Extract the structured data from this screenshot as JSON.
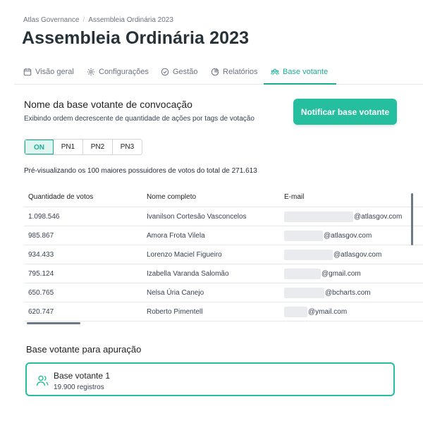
{
  "breadcrumb": {
    "root": "Atlas Governance",
    "current": "Assembleia Ordinária 2023"
  },
  "page_title": "Assembleia Ordinária 2023",
  "tabs": [
    {
      "label": "Visão geral",
      "icon": "calendar-icon"
    },
    {
      "label": "Configurações",
      "icon": "gear-icon"
    },
    {
      "label": "Gestão",
      "icon": "check-circle-icon"
    },
    {
      "label": "Relatórios",
      "icon": "pie-chart-icon"
    },
    {
      "label": "Base votante",
      "icon": "users-icon",
      "active": true
    }
  ],
  "section": {
    "title": "Nome da base votante de convocação",
    "subtitle": "Exibindo ordem decrescente de quantidade de ações por tags de votação",
    "notify_button": "Notificar base votante"
  },
  "filters": {
    "items": [
      "ON",
      "PN1",
      "PN2",
      "PN3"
    ],
    "selected": "ON"
  },
  "preview_note": "Pré-visualizando os 100 maiores possuidores de votos do total de 271.613",
  "table": {
    "headers": [
      "Quantidade de votos",
      "Nome completo",
      "E-mail"
    ],
    "rows": [
      {
        "votes": "1.098.546",
        "name": "Ivanilson Cortesão Vasconcelos",
        "email": "@atlasgov.com"
      },
      {
        "votes": "985.867",
        "name": "Amora Frota Vilela",
        "email": "@atlasgov.com"
      },
      {
        "votes": "934.433",
        "name": "Lorenzo Maciel Figueiro",
        "email": "@atlasgov.com"
      },
      {
        "votes": "795.124",
        "name": "Izabella Varanda Salomão",
        "email": "@gmail.com"
      },
      {
        "votes": "650.765",
        "name": "Nelsa Úria Canejo",
        "email": "@bcharts.com"
      },
      {
        "votes": "620.747",
        "name": "Roberto Pimentell",
        "email": "@ymail.com"
      }
    ]
  },
  "apuracao": {
    "title": "Base votante para apuração",
    "card": {
      "name": "Base votante 1",
      "count": "19.900 registros",
      "icon": "users-icon"
    }
  },
  "colors": {
    "accent": "#25bf9f",
    "accent_text": "#1aae95",
    "title": "#263238"
  }
}
